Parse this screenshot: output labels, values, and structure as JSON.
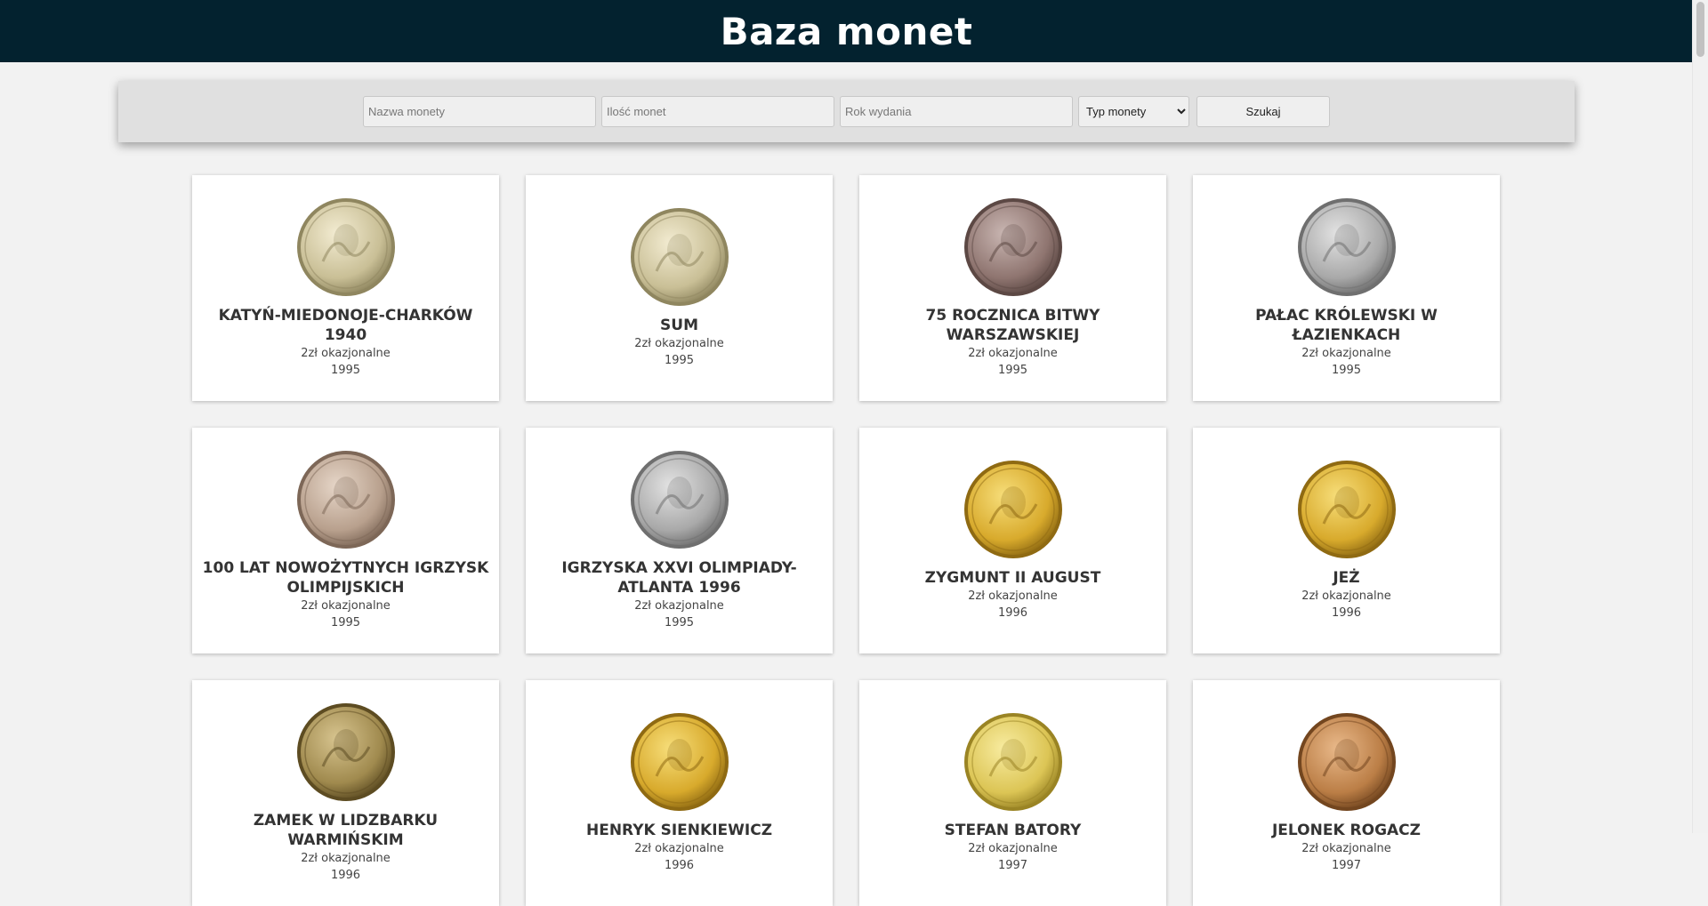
{
  "header": {
    "title": "Baza monet"
  },
  "search": {
    "name_placeholder": "Nazwa monety",
    "count_placeholder": "Ilość monet",
    "year_placeholder": "Rok wydania",
    "type_selected": "Typ monety",
    "submit_label": "Szukaj"
  },
  "coins": [
    {
      "name": "KATYŃ-MIEDONOJE-CHARKÓW 1940",
      "type": "2zł okazjonalne",
      "year": "1995",
      "metal": "silver",
      "icon": "coin-katyn-icon"
    },
    {
      "name": "SUM",
      "type": "2zł okazjonalne",
      "year": "1995",
      "metal": "silver",
      "icon": "coin-catfish-icon"
    },
    {
      "name": "75 ROCZNICA BITWY WARSZAWSKIEJ",
      "type": "2zł okazjonalne",
      "year": "1995",
      "metal": "dark",
      "icon": "coin-battle-icon"
    },
    {
      "name": "PAŁAC KRÓLEWSKI W ŁAZIENKACH",
      "type": "2zł okazjonalne",
      "year": "1995",
      "metal": "grey",
      "icon": "coin-palace-icon"
    },
    {
      "name": "100 LAT NOWOŻYTNYCH IGRZYSK OLIMPIJSKICH",
      "type": "2zł okazjonalne",
      "year": "1995",
      "metal": "bronze",
      "icon": "coin-olympics-icon"
    },
    {
      "name": "IGRZYSKA XXVI OLIMPIADY-ATLANTA 1996",
      "type": "2zł okazjonalne",
      "year": "1995",
      "metal": "grey",
      "icon": "coin-wrestlers-icon"
    },
    {
      "name": "ZYGMUNT II AUGUST",
      "type": "2zł okazjonalne",
      "year": "1996",
      "metal": "gold",
      "icon": "coin-king-icon"
    },
    {
      "name": "JEŻ",
      "type": "2zł okazjonalne",
      "year": "1996",
      "metal": "gold",
      "icon": "coin-hedgehog-icon"
    },
    {
      "name": "ZAMEK W LIDZBARKU WARMIŃSKIM",
      "type": "2zł okazjonalne",
      "year": "1996",
      "metal": "bronze-dark",
      "icon": "coin-castle-icon"
    },
    {
      "name": "HENRYK SIENKIEWICZ",
      "type": "2zł okazjonalne",
      "year": "1996",
      "metal": "gold",
      "icon": "coin-writer-icon"
    },
    {
      "name": "STEFAN BATORY",
      "type": "2zł okazjonalne",
      "year": "1997",
      "metal": "gold-pale",
      "icon": "coin-batory-icon"
    },
    {
      "name": "JELONEK ROGACZ",
      "type": "2zł okazjonalne",
      "year": "1997",
      "metal": "copper",
      "icon": "coin-beetle-icon"
    }
  ],
  "colors": {
    "header_bg": "#03222f",
    "page_bg": "#f2f2f2",
    "card_bg": "#ffffff"
  }
}
